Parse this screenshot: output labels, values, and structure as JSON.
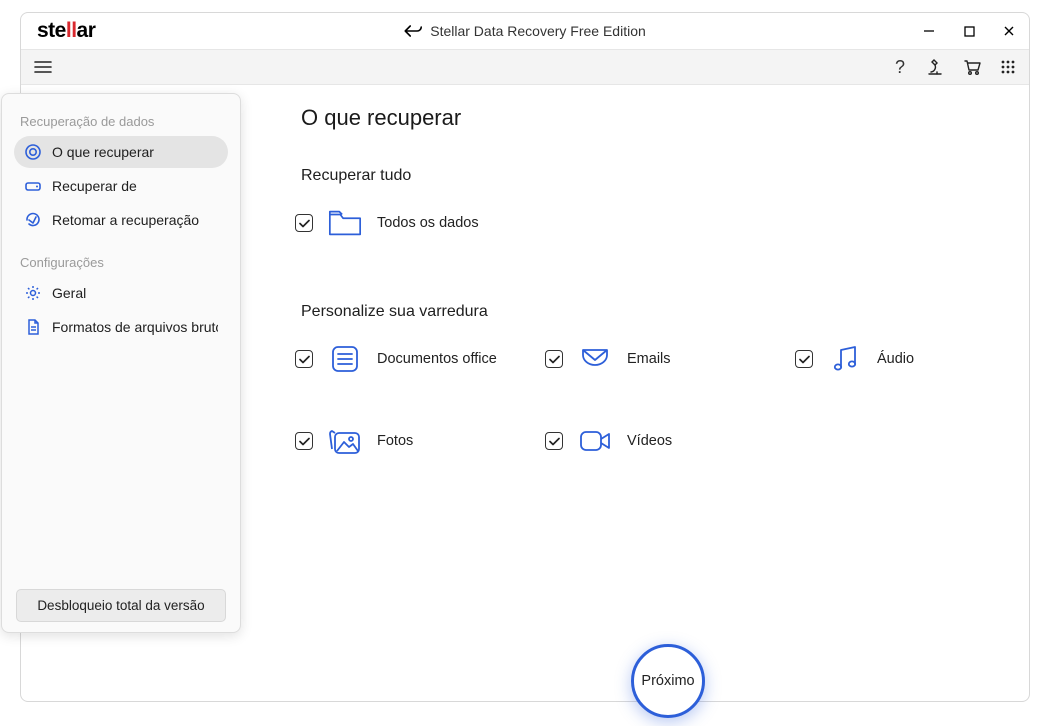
{
  "titlebar": {
    "app_title": "Stellar Data Recovery Free Edition",
    "logo_prefix": "ste",
    "logo_accent": "ll",
    "logo_suffix": "ar"
  },
  "sidebar": {
    "section1_title": "Recuperação de dados",
    "item_what": "O que recuperar",
    "item_from": "Recuperar de",
    "item_resume": "Retomar a recuperação",
    "section2_title": "Configurações",
    "item_general": "Geral",
    "item_raw": "Formatos de arquivos brutos",
    "unlock_label": "Desbloqueio total da versão"
  },
  "main": {
    "page_title": "O que recuperar",
    "recover_all_title": "Recuperar tudo",
    "all_data_label": "Todos os dados",
    "customize_title": "Personalize sua varredura",
    "options": {
      "docs": "Documentos office",
      "emails": "Emails",
      "audio": "Áudio",
      "photos": "Fotos",
      "videos": "Vídeos"
    }
  },
  "next_label": "Próximo"
}
